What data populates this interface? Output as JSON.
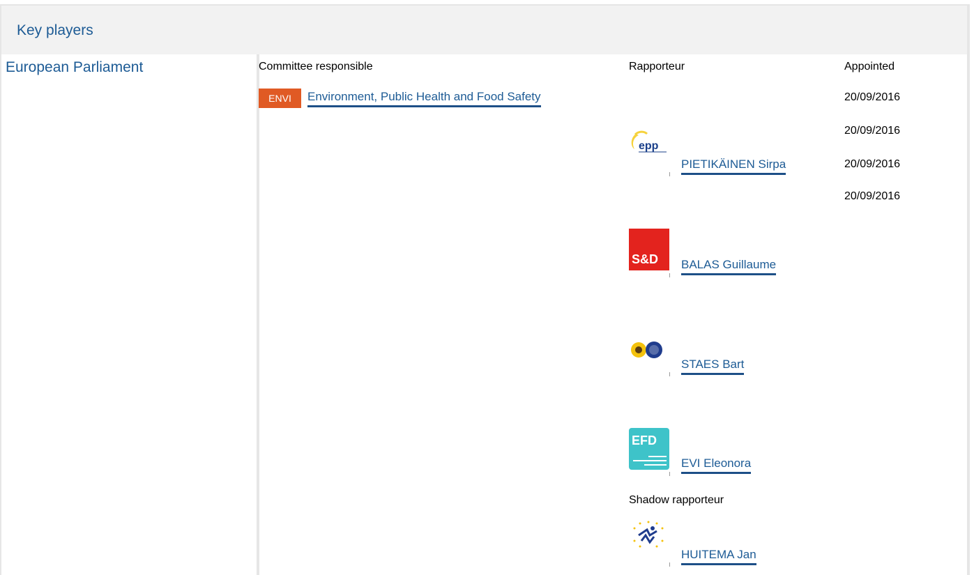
{
  "header": {
    "title": "Key players"
  },
  "institution": {
    "name": "European Parliament"
  },
  "columns": {
    "committee": "Committee responsible",
    "rapporteur": "Rapporteur",
    "appointed": "Appointed"
  },
  "committee": {
    "code": "ENVI",
    "name": "Environment, Public Health and Food Safety"
  },
  "dates": [
    "20/09/2016",
    "20/09/2016",
    "20/09/2016",
    "20/09/2016"
  ],
  "rapporteurs": [
    {
      "name": "PIETIKÄINEN Sirpa",
      "group_icon": "epp-logo-icon"
    },
    {
      "name": "BALAS Guillaume",
      "group_icon": "sd-logo-icon"
    },
    {
      "name": "STAES Bart",
      "group_icon": "greens-efa-logo-icon"
    },
    {
      "name": "EVI Eleonora",
      "group_icon": "efdd-logo-icon"
    }
  ],
  "shadow": {
    "label": "Shadow rapporteur",
    "people": [
      {
        "name": "HUITEMA Jan",
        "group_icon": "alde-logo-icon"
      }
    ]
  },
  "logos": {
    "epp_text": "epp",
    "sd_text": "S&D",
    "efd_text": "EFD"
  },
  "colors": {
    "link": "#1d5b95",
    "badge": "#e05a24",
    "header_bg": "#f2f2f2",
    "border": "#e6e6e6",
    "sd_red": "#e3231e",
    "efd_teal": "#3ec3c9"
  }
}
